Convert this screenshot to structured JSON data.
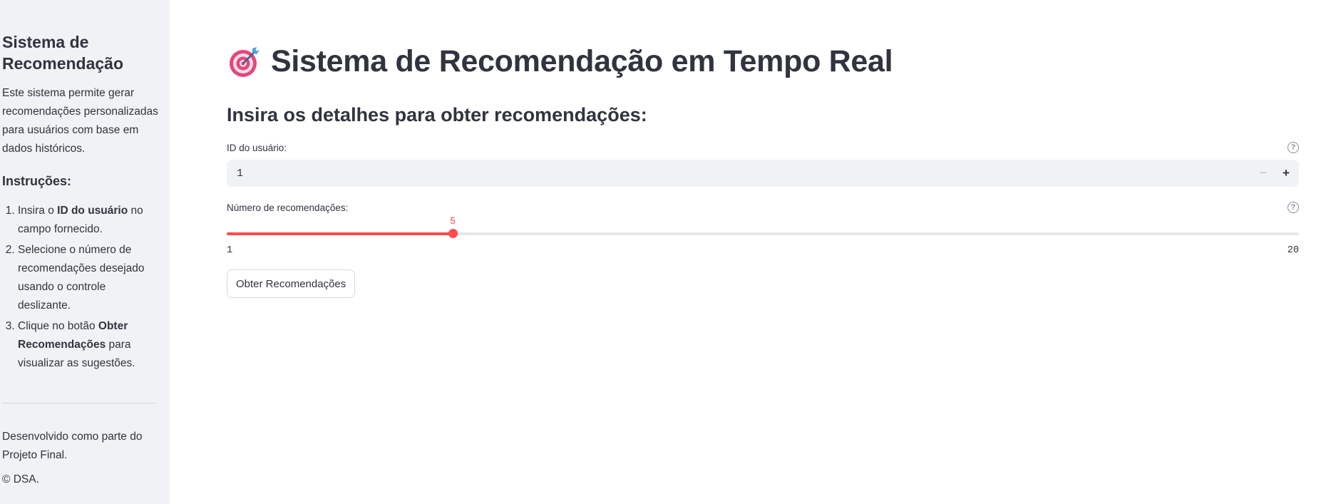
{
  "sidebar": {
    "title": "Sistema de Recomendação",
    "description": "Este sistema permite gerar recomendações personalizadas para usuários com base em dados históricos.",
    "instructions_heading": "Instruções:",
    "steps": [
      {
        "before": "Insira o ",
        "bold": "ID do usuário",
        "after": " no campo fornecido."
      },
      {
        "before": "Selecione o número de recomendações desejado usando o controle deslizante.",
        "bold": "",
        "after": ""
      },
      {
        "before": "Clique no botão ",
        "bold": "Obter Recomendações",
        "after": " para visualizar as sugestões."
      }
    ],
    "footer_line": "Desenvolvido como parte do Projeto Final.",
    "copyright": "© DSA."
  },
  "main": {
    "title_icon": "target-dart-icon",
    "title": "Sistema de Recomendação em Tempo Real",
    "subheader": "Insira os detalhes para obter recomendações:",
    "user_id": {
      "label": "ID do usuário:",
      "value": "1",
      "minus": "−",
      "plus": "+"
    },
    "num_recs": {
      "label": "Número de recomendações:",
      "min": 1,
      "max": 20,
      "value": 5
    },
    "submit_label": "Obter Recomendações"
  },
  "colors": {
    "accent": "#ff4b4b",
    "sidebar_bg": "#f0f2f6",
    "text": "#31333f"
  }
}
